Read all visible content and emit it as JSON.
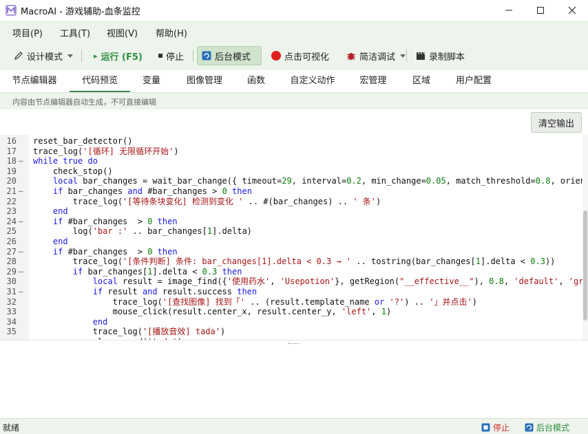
{
  "window": {
    "title": "MacroAI - 游戏辅助-血条监控",
    "logo_icon": "app-logo-icon",
    "controls": [
      "minimize-icon",
      "maximize-icon",
      "close-icon"
    ]
  },
  "menu": {
    "items": [
      {
        "label": "项目(P)"
      },
      {
        "label": "工具(T)"
      },
      {
        "label": "视图(V)"
      },
      {
        "label": "帮助(H)"
      }
    ]
  },
  "toolbar": {
    "design_mode": "设计模式",
    "run": "运行 (F5)",
    "stop": "停止",
    "background_mode": "后台模式",
    "click_visualize": "点击可视化",
    "simple_debug": "简洁调试",
    "record_script": "录制脚本",
    "colors": {
      "run": "#2e8b3e",
      "record_dot": "#e02020",
      "accent": "#2a6fb8"
    }
  },
  "tabs": [
    {
      "label": "节点编辑器",
      "active": false
    },
    {
      "label": "代码预览",
      "active": true
    },
    {
      "label": "变量",
      "active": false
    },
    {
      "label": "图像管理",
      "active": false
    },
    {
      "label": "函数",
      "active": false
    },
    {
      "label": "自定义动作",
      "active": false
    },
    {
      "label": "宏管理",
      "active": false
    },
    {
      "label": "区域",
      "active": false
    },
    {
      "label": "用户配置",
      "active": false
    }
  ],
  "notice": "内容由节点编辑器自动生成，不可直接编辑",
  "clear_output": "清空输出",
  "code": [
    {
      "n": "16",
      "fold": "",
      "text": "reset_bar_detector()"
    },
    {
      "n": "17",
      "fold": "",
      "text": "trace_log('[循环] 无限循环开始')"
    },
    {
      "n": "18",
      "fold": "–",
      "text": "while true do"
    },
    {
      "n": "19",
      "fold": "",
      "text": "    check_stop()"
    },
    {
      "n": "20",
      "fold": "",
      "text": "    local bar_changes = wait_bar_change({ timeout=29, interval=0.2, min_change=0.05, match_threshold=0.8, orientat"
    },
    {
      "n": "21",
      "fold": "–",
      "text": "    if bar_changes and #bar_changes > 0 then"
    },
    {
      "n": "22",
      "fold": "",
      "text": "        trace_log('[等待条块变化] 检测到变化 ' .. #(bar_changes) .. ' 条')"
    },
    {
      "n": "23",
      "fold": "",
      "text": "    end"
    },
    {
      "n": "24",
      "fold": "–",
      "text": "    if #bar_changes  > 0 then"
    },
    {
      "n": "25",
      "fold": "",
      "text": "        log('bar :' .. bar_changes[1].delta)"
    },
    {
      "n": "26",
      "fold": "",
      "text": "    end"
    },
    {
      "n": "27",
      "fold": "–",
      "text": "    if #bar_changes  > 0 then"
    },
    {
      "n": "28",
      "fold": "",
      "text": "        trace_log('[条件判断] 条件: bar_changes[1].delta < 0.3 → ' .. tostring(bar_changes[1].delta < 0.3))"
    },
    {
      "n": "29",
      "fold": "–",
      "text": "        if bar_changes[1].delta < 0.3 then"
    },
    {
      "n": "30",
      "fold": "",
      "text": "            local result = image_find({'使用药水', 'Usepotion'}, getRegion(\"__effective__\"), 0.8, 'default', 'grays"
    },
    {
      "n": "31",
      "fold": "–",
      "text": "            if result and result.success then"
    },
    {
      "n": "32",
      "fold": "",
      "text": "                trace_log('[查找图像] 找到「' .. (result.template_name or '?') .. '」并点击')"
    },
    {
      "n": "33",
      "fold": "",
      "text": "                mouse_click(result.center_x, result.center_y, 'left', 1)"
    },
    {
      "n": "34",
      "fold": "",
      "text": "            end"
    },
    {
      "n": "35",
      "fold": "",
      "text": "            trace_log('[播放音效] tada')"
    },
    {
      "n": "",
      "fold": "",
      "text": "            play_sound('tada')"
    }
  ],
  "status": {
    "ready": "就绪",
    "stop": "停止",
    "background_mode": "后台模式"
  }
}
